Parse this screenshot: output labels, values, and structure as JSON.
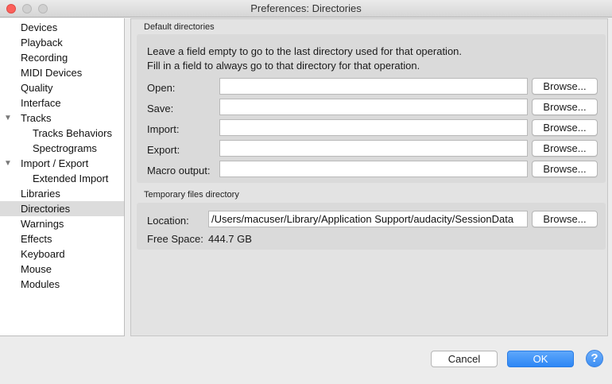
{
  "window": {
    "title": "Preferences: Directories"
  },
  "sidebar": {
    "items": [
      {
        "label": "Devices"
      },
      {
        "label": "Playback"
      },
      {
        "label": "Recording"
      },
      {
        "label": "MIDI Devices"
      },
      {
        "label": "Quality"
      },
      {
        "label": "Interface"
      },
      {
        "label": "Tracks"
      },
      {
        "label": "Tracks Behaviors"
      },
      {
        "label": "Spectrograms"
      },
      {
        "label": "Import / Export"
      },
      {
        "label": "Extended Import"
      },
      {
        "label": "Libraries"
      },
      {
        "label": "Directories"
      },
      {
        "label": "Warnings"
      },
      {
        "label": "Effects"
      },
      {
        "label": "Keyboard"
      },
      {
        "label": "Mouse"
      },
      {
        "label": "Modules"
      }
    ],
    "selected": "Directories"
  },
  "default_dirs": {
    "title": "Default directories",
    "desc_line1": "Leave a field empty to go to the last directory used for that operation.",
    "desc_line2": "Fill in a field to always go to that directory for that operation.",
    "rows": [
      {
        "label": "Open:",
        "value": "",
        "button": "Browse..."
      },
      {
        "label": "Save:",
        "value": "",
        "button": "Browse..."
      },
      {
        "label": "Import:",
        "value": "",
        "button": "Browse..."
      },
      {
        "label": "Export:",
        "value": "",
        "button": "Browse..."
      },
      {
        "label": "Macro output:",
        "value": "",
        "button": "Browse..."
      }
    ]
  },
  "temp_dir": {
    "title": "Temporary files directory",
    "location_label": "Location:",
    "location_value": "/Users/macuser/Library/Application Support/audacity/SessionData",
    "browse": "Browse...",
    "free_space_label": "Free Space:",
    "free_space_value": "444.7 GB"
  },
  "footer": {
    "cancel": "Cancel",
    "ok": "OK",
    "help": "?"
  },
  "colors": {
    "ok_button": "#2d87f5",
    "close_button": "#fc605b",
    "selected_row": "#dcdcdc"
  }
}
